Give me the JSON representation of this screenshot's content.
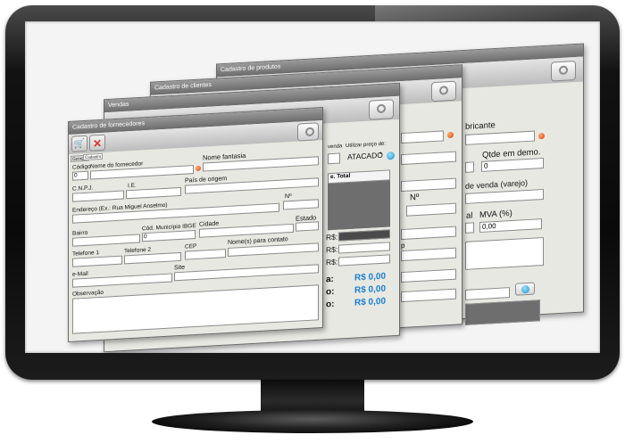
{
  "windows": {
    "produtos": {
      "title": "Cadastro de produtos",
      "fabricante_label": "bricante",
      "qtde_label": "Qtde em demo.",
      "qtde_value": "0",
      "preco_label": "de venda (varejo)",
      "mva_label": "MVA (%)",
      "mva_value": "0,00",
      "al_label": "al"
    },
    "clientes": {
      "title": "Cadastro de clientes",
      "numero_label": "Nº",
      "p_label": "p"
    },
    "vendas": {
      "title": "Vendas",
      "venda_label": "venda",
      "utilizar_label": "Utilizar preço de:",
      "preco_option": "ATACADO",
      "total_label": "e. Total",
      "rs_label": "R$:",
      "rows": [
        {
          "label": "a:",
          "value": "R$ 0,00"
        },
        {
          "label": "o:",
          "value": "R$ 0,00"
        },
        {
          "label": "o:",
          "value": "R$ 0,00"
        }
      ]
    },
    "fornecedores": {
      "title": "Cadastro de fornecedores",
      "tabs": [
        "Geração",
        "Cadastro"
      ],
      "codigo_label": "Código",
      "codigo_value": "0",
      "nome_label": "Nome do fornecedor",
      "fantasia_label": "Nome fantasia",
      "cnpj_label": "C.N.P.J.",
      "ie_label": "I.E.",
      "pais_label": "País de origem",
      "endereco_label": "Endereço (Ex.: Rua Miguel Anselmo)",
      "numero_label": "Nº",
      "bairro_label": "Bairro",
      "ibge_label": "Cód. Município IBGE",
      "ibge_value": "0",
      "cidade_label": "Cidade",
      "estado_label": "Estado",
      "tel1_label": "Telefone 1",
      "tel2_label": "Telefone 2",
      "cep_label": "CEP",
      "contato_label": "Nome(s) para contato",
      "email_label": "e-Mail",
      "site_label": "Site",
      "obs_label": "Observação"
    }
  }
}
